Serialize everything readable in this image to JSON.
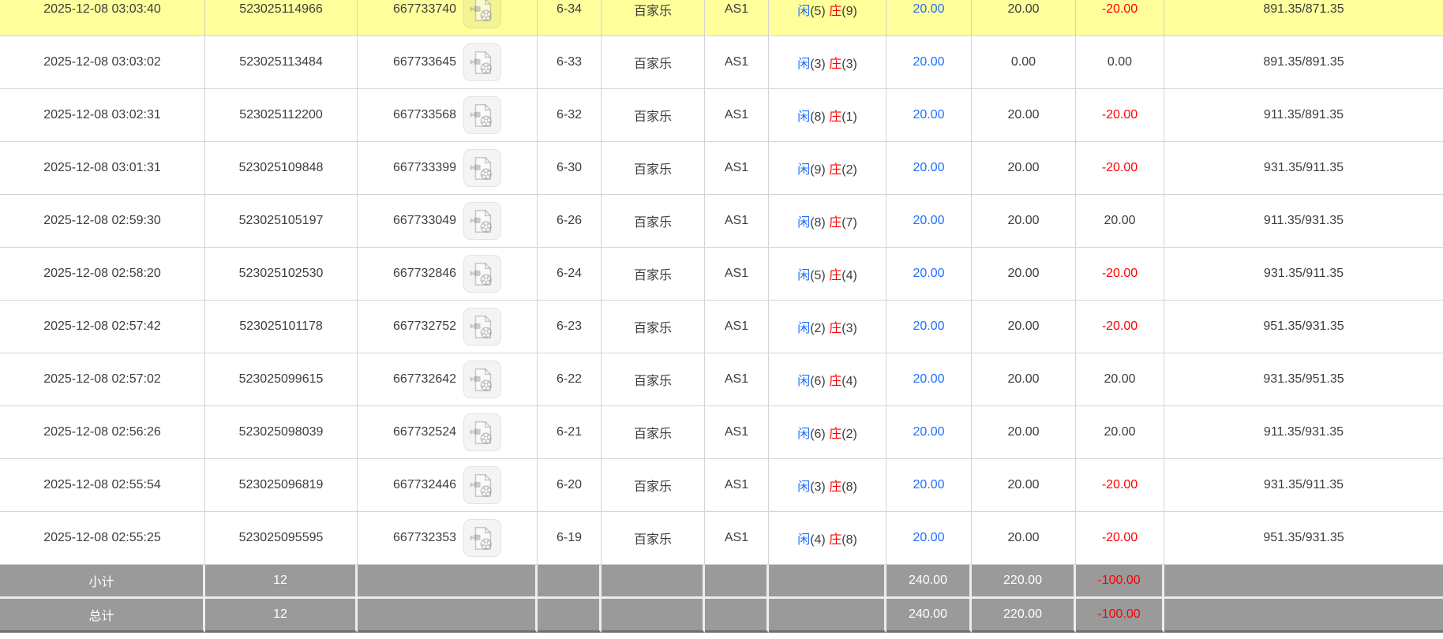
{
  "labels": {
    "player_char": "闲",
    "banker_char": "庄"
  },
  "colors": {
    "highlight_yellow": "#ffff9c",
    "link_blue": "#1e6fff",
    "negative_red": "#ff0000",
    "totals_gray": "#9a9a9a",
    "body_text": "#3d3d3d"
  },
  "icons": {
    "video_replay": "video-icon"
  },
  "rows": [
    {
      "time": "2025-12-08 03:03:40",
      "bet_no": "523025114966",
      "game_no": "667733740",
      "round": "6-34",
      "game": "百家乐",
      "table": "AS1",
      "player_pts": "(5)",
      "banker_pts": "(9)",
      "bet": "20.00",
      "valid": "20.00",
      "winloss": "-20.00",
      "balance": "891.35/871.35",
      "highlighted": true
    },
    {
      "time": "2025-12-08 03:03:02",
      "bet_no": "523025113484",
      "game_no": "667733645",
      "round": "6-33",
      "game": "百家乐",
      "table": "AS1",
      "player_pts": "(3)",
      "banker_pts": "(3)",
      "bet": "20.00",
      "valid": "0.00",
      "winloss": "0.00",
      "balance": "891.35/891.35",
      "highlighted": false
    },
    {
      "time": "2025-12-08 03:02:31",
      "bet_no": "523025112200",
      "game_no": "667733568",
      "round": "6-32",
      "game": "百家乐",
      "table": "AS1",
      "player_pts": "(8)",
      "banker_pts": "(1)",
      "bet": "20.00",
      "valid": "20.00",
      "winloss": "-20.00",
      "balance": "911.35/891.35",
      "highlighted": false
    },
    {
      "time": "2025-12-08 03:01:31",
      "bet_no": "523025109848",
      "game_no": "667733399",
      "round": "6-30",
      "game": "百家乐",
      "table": "AS1",
      "player_pts": "(9)",
      "banker_pts": "(2)",
      "bet": "20.00",
      "valid": "20.00",
      "winloss": "-20.00",
      "balance": "931.35/911.35",
      "highlighted": false
    },
    {
      "time": "2025-12-08 02:59:30",
      "bet_no": "523025105197",
      "game_no": "667733049",
      "round": "6-26",
      "game": "百家乐",
      "table": "AS1",
      "player_pts": "(8)",
      "banker_pts": "(7)",
      "bet": "20.00",
      "valid": "20.00",
      "winloss": "20.00",
      "balance": "911.35/931.35",
      "highlighted": false
    },
    {
      "time": "2025-12-08 02:58:20",
      "bet_no": "523025102530",
      "game_no": "667732846",
      "round": "6-24",
      "game": "百家乐",
      "table": "AS1",
      "player_pts": "(5)",
      "banker_pts": "(4)",
      "bet": "20.00",
      "valid": "20.00",
      "winloss": "-20.00",
      "balance": "931.35/911.35",
      "highlighted": false
    },
    {
      "time": "2025-12-08 02:57:42",
      "bet_no": "523025101178",
      "game_no": "667732752",
      "round": "6-23",
      "game": "百家乐",
      "table": "AS1",
      "player_pts": "(2)",
      "banker_pts": "(3)",
      "bet": "20.00",
      "valid": "20.00",
      "winloss": "-20.00",
      "balance": "951.35/931.35",
      "highlighted": false
    },
    {
      "time": "2025-12-08 02:57:02",
      "bet_no": "523025099615",
      "game_no": "667732642",
      "round": "6-22",
      "game": "百家乐",
      "table": "AS1",
      "player_pts": "(6)",
      "banker_pts": "(4)",
      "bet": "20.00",
      "valid": "20.00",
      "winloss": "20.00",
      "balance": "931.35/951.35",
      "highlighted": false
    },
    {
      "time": "2025-12-08 02:56:26",
      "bet_no": "523025098039",
      "game_no": "667732524",
      "round": "6-21",
      "game": "百家乐",
      "table": "AS1",
      "player_pts": "(6)",
      "banker_pts": "(2)",
      "bet": "20.00",
      "valid": "20.00",
      "winloss": "20.00",
      "balance": "911.35/931.35",
      "highlighted": false
    },
    {
      "time": "2025-12-08 02:55:54",
      "bet_no": "523025096819",
      "game_no": "667732446",
      "round": "6-20",
      "game": "百家乐",
      "table": "AS1",
      "player_pts": "(3)",
      "banker_pts": "(8)",
      "bet": "20.00",
      "valid": "20.00",
      "winloss": "-20.00",
      "balance": "931.35/911.35",
      "highlighted": false
    },
    {
      "time": "2025-12-08 02:55:25",
      "bet_no": "523025095595",
      "game_no": "667732353",
      "round": "6-19",
      "game": "百家乐",
      "table": "AS1",
      "player_pts": "(4)",
      "banker_pts": "(8)",
      "bet": "20.00",
      "valid": "20.00",
      "winloss": "-20.00",
      "balance": "951.35/931.35",
      "highlighted": false
    }
  ],
  "footer": {
    "subtotal": {
      "label": "小计",
      "count": "12",
      "bet": "240.00",
      "valid": "220.00",
      "winloss": "-100.00"
    },
    "total": {
      "label": "总计",
      "count": "12",
      "bet": "240.00",
      "valid": "220.00",
      "winloss": "-100.00"
    }
  }
}
